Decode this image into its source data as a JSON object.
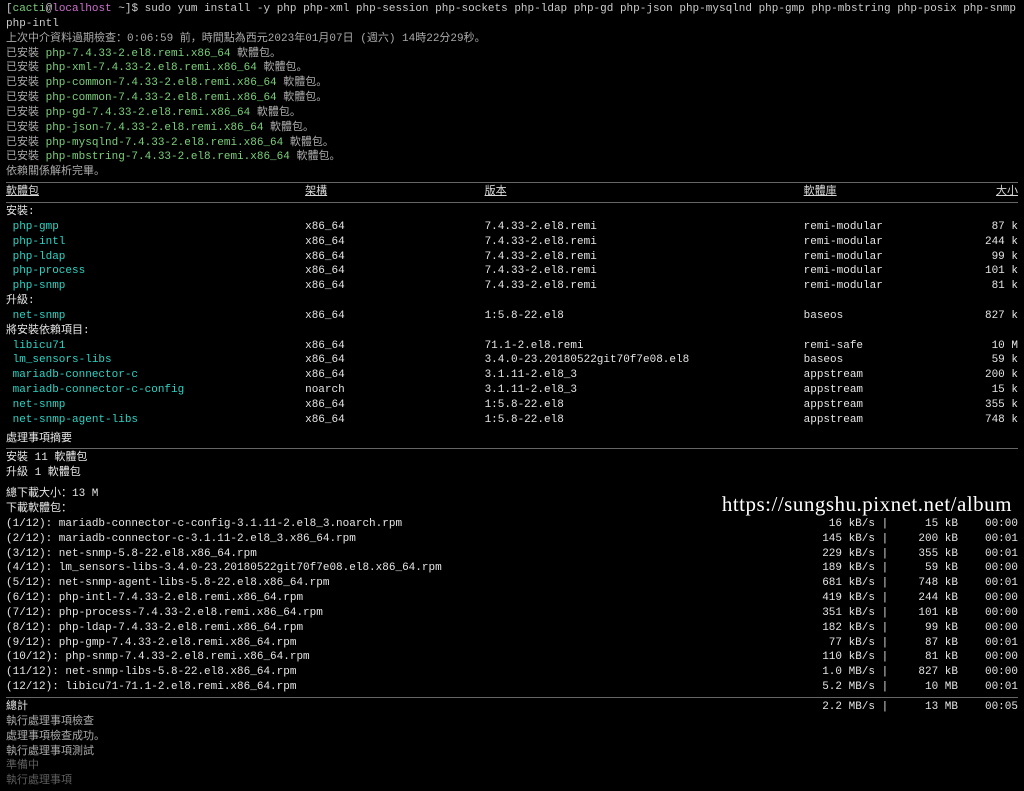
{
  "prompt": {
    "user": "cacti",
    "at": "@",
    "host": "localhost",
    "path": " ~]$ ",
    "cmd": "sudo yum install -y php php-xml php-session php-sockets php-ldap php-gd php-json php-mysqlnd php-gmp php-mbstring php-posix php-snmp php-intl"
  },
  "meta_line": "上次中介資料過期檢查：0:06:59 前，時間點為西元2023年01月07日 (週六) 14時22分29秒。",
  "already": {
    "prefix": "已安裝 ",
    "suffix": " 軟體包。",
    "items": [
      "php-7.4.33-2.el8.remi.x86_64",
      "php-xml-7.4.33-2.el8.remi.x86_64",
      "php-common-7.4.33-2.el8.remi.x86_64",
      "php-common-7.4.33-2.el8.remi.x86_64",
      "php-gd-7.4.33-2.el8.remi.x86_64",
      "php-json-7.4.33-2.el8.remi.x86_64",
      "php-mysqlnd-7.4.33-2.el8.remi.x86_64",
      "php-mbstring-7.4.33-2.el8.remi.x86_64"
    ]
  },
  "deps_done": "依賴關係解析完畢。",
  "headers": {
    "pkg": "軟體包",
    "arch": "架構",
    "ver": "版本",
    "repo": "軟體庫",
    "size": "大小"
  },
  "sections": {
    "install": "安裝:",
    "upgrade": "升級:",
    "install_deps": "將安裝依賴項目:"
  },
  "install_rows": [
    {
      "name": "php-gmp",
      "arch": "x86_64",
      "ver": "7.4.33-2.el8.remi",
      "repo": "remi-modular",
      "size": "87 k"
    },
    {
      "name": "php-intl",
      "arch": "x86_64",
      "ver": "7.4.33-2.el8.remi",
      "repo": "remi-modular",
      "size": "244 k"
    },
    {
      "name": "php-ldap",
      "arch": "x86_64",
      "ver": "7.4.33-2.el8.remi",
      "repo": "remi-modular",
      "size": "99 k"
    },
    {
      "name": "php-process",
      "arch": "x86_64",
      "ver": "7.4.33-2.el8.remi",
      "repo": "remi-modular",
      "size": "101 k"
    },
    {
      "name": "php-snmp",
      "arch": "x86_64",
      "ver": "7.4.33-2.el8.remi",
      "repo": "remi-modular",
      "size": "81 k"
    }
  ],
  "upgrade_rows": [
    {
      "name": "net-snmp",
      "arch": "x86_64",
      "ver": "1:5.8-22.el8",
      "repo": "baseos",
      "size": "827 k"
    }
  ],
  "dep_rows": [
    {
      "name": "libicu71",
      "arch": "x86_64",
      "ver": "71.1-2.el8.remi",
      "repo": "remi-safe",
      "size": "10 M"
    },
    {
      "name": "lm_sensors-libs",
      "arch": "x86_64",
      "ver": "3.4.0-23.20180522git70f7e08.el8",
      "repo": "baseos",
      "size": "59 k"
    },
    {
      "name": "mariadb-connector-c",
      "arch": "x86_64",
      "ver": "3.1.11-2.el8_3",
      "repo": "appstream",
      "size": "200 k"
    },
    {
      "name": "mariadb-connector-c-config",
      "arch": "noarch",
      "ver": "3.1.11-2.el8_3",
      "repo": "appstream",
      "size": "15 k"
    },
    {
      "name": "net-snmp",
      "arch": "x86_64",
      "ver": "1:5.8-22.el8",
      "repo": "appstream",
      "size": "355 k"
    },
    {
      "name": "net-snmp-agent-libs",
      "arch": "x86_64",
      "ver": "1:5.8-22.el8",
      "repo": "appstream",
      "size": "748 k"
    }
  ],
  "summary": {
    "header": "處理事項摘要",
    "install": "安裝  11 軟體包",
    "upgrade": "升級   1 軟體包",
    "total_dl": "總下載大小：13 M",
    "dl_header": "下載軟體包："
  },
  "downloads": [
    {
      "n": "(1/12): mariadb-connector-c-config-3.1.11-2.el8_3.noarch.rpm",
      "rate": "16 kB/s",
      "tot": "15 kB",
      "time": "00:00"
    },
    {
      "n": "(2/12): mariadb-connector-c-3.1.11-2.el8_3.x86_64.rpm",
      "rate": "145 kB/s",
      "tot": "200 kB",
      "time": "00:01"
    },
    {
      "n": "(3/12): net-snmp-5.8-22.el8.x86_64.rpm",
      "rate": "229 kB/s",
      "tot": "355 kB",
      "time": "00:01"
    },
    {
      "n": "(4/12): lm_sensors-libs-3.4.0-23.20180522git70f7e08.el8.x86_64.rpm",
      "rate": "189 kB/s",
      "tot": "59 kB",
      "time": "00:00"
    },
    {
      "n": "(5/12): net-snmp-agent-libs-5.8-22.el8.x86_64.rpm",
      "rate": "681 kB/s",
      "tot": "748 kB",
      "time": "00:01"
    },
    {
      "n": "(6/12): php-intl-7.4.33-2.el8.remi.x86_64.rpm",
      "rate": "419 kB/s",
      "tot": "244 kB",
      "time": "00:00"
    },
    {
      "n": "(7/12): php-process-7.4.33-2.el8.remi.x86_64.rpm",
      "rate": "351 kB/s",
      "tot": "101 kB",
      "time": "00:00"
    },
    {
      "n": "(8/12): php-ldap-7.4.33-2.el8.remi.x86_64.rpm",
      "rate": "182 kB/s",
      "tot": "99 kB",
      "time": "00:00"
    },
    {
      "n": "(9/12): php-gmp-7.4.33-2.el8.remi.x86_64.rpm",
      "rate": "77 kB/s",
      "tot": "87 kB",
      "time": "00:01"
    },
    {
      "n": "(10/12): php-snmp-7.4.33-2.el8.remi.x86_64.rpm",
      "rate": "110 kB/s",
      "tot": "81 kB",
      "time": "00:00"
    },
    {
      "n": "(11/12): net-snmp-libs-5.8-22.el8.x86_64.rpm",
      "rate": "1.0 MB/s",
      "tot": "827 kB",
      "time": "00:00"
    },
    {
      "n": "(12/12): libicu71-71.1-2.el8.remi.x86_64.rpm",
      "rate": "5.2 MB/s",
      "tot": "10 MB",
      "time": "00:01"
    }
  ],
  "total_row": {
    "label": "總計",
    "rate": "2.2 MB/s",
    "tot": "13 MB",
    "time": "00:05"
  },
  "trailing": [
    "執行處理事項檢查",
    "處理事項檢查成功。",
    "執行處理事項測試"
  ],
  "trailing_faded": [
    "準備中",
    "執行處理事項"
  ],
  "watermark": "https://sungshu.pixnet.net/album"
}
